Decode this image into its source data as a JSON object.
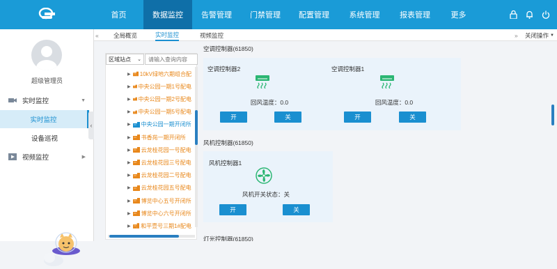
{
  "nav": {
    "items": [
      "首页",
      "数据监控",
      "告警管理",
      "门禁管理",
      "配置管理",
      "系统管理",
      "报表管理",
      "更多"
    ],
    "active": "数据监控"
  },
  "user": {
    "name": "超级管理员"
  },
  "sidebar": {
    "realtime": "实时监控",
    "realtime_sub": "实时监控",
    "device_tour": "设备巡视",
    "video": "视频监控"
  },
  "tabs": {
    "overview": "全局概览",
    "realtime": "实时监控",
    "video": "视频监控",
    "close_ops": "关闭操作"
  },
  "tree": {
    "select_label": "区域站点",
    "search_placeholder": "请输入查询内容",
    "items": [
      {
        "label": "10kV绿地六期组合配",
        "color": "#e8871a"
      },
      {
        "label": "中央公园一期1号配电",
        "color": "#e8871a"
      },
      {
        "label": "中央公园一期2号配电",
        "color": "#e8871a"
      },
      {
        "label": "中央公园一期5号配电",
        "color": "#e8871a"
      },
      {
        "label": "中央公园一期开闭所",
        "color": "#1a8fd0"
      },
      {
        "label": "书香苑一期开闭所",
        "color": "#e8871a"
      },
      {
        "label": "云龙桂花园一号配电",
        "color": "#e8871a"
      },
      {
        "label": "云龙桂花园三号配电",
        "color": "#e8871a"
      },
      {
        "label": "云龙桂花园二号配电",
        "color": "#e8871a"
      },
      {
        "label": "云龙桂花园五号配电",
        "color": "#e8871a"
      },
      {
        "label": "博览中心五号开闭所",
        "color": "#e8871a"
      },
      {
        "label": "博览中心六号开闭所",
        "color": "#e8871a"
      },
      {
        "label": "和平壹号三期1#配电",
        "color": "#e8871a"
      }
    ]
  },
  "main": {
    "ac_section_partial": "空调控制器(61850)",
    "ac_controllers": [
      {
        "name": "空调控制器2",
        "status": "回风温度：0.0",
        "on": "开",
        "off": "关"
      },
      {
        "name": "空调控制器1",
        "status": "回风温度：0.0",
        "on": "开",
        "off": "关"
      }
    ],
    "fan_section": "风机控制器(61850)",
    "fan_controllers": [
      {
        "name": "风机控制器1",
        "status": "风机开关状态：关",
        "on": "开",
        "off": "关"
      }
    ],
    "light_section_partial": "灯光控制器(61850)"
  },
  "colors": {
    "primary": "#1a9bd7",
    "active_nav": "#0f6fa8",
    "button": "#1a8fd0",
    "tree_orange": "#e8871a",
    "card_bg": "#eaf3fb"
  }
}
